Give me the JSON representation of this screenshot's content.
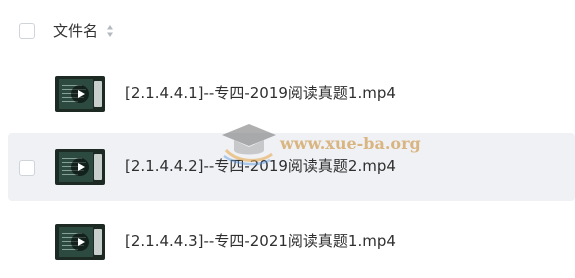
{
  "header": {
    "column_label": "文件名"
  },
  "files": [
    {
      "name": "[2.1.4.4.1]--专四-2019阅读真题1.mp4",
      "type": "video"
    },
    {
      "name": "[2.1.4.4.2]--专四-2019阅读真题2.mp4",
      "type": "video"
    },
    {
      "name": "[2.1.4.4.3]--专四-2021阅读真题1.mp4",
      "type": "video"
    }
  ],
  "watermark": {
    "text": "www.xue-ba.org"
  },
  "colors": {
    "hover_row": "#eff1f5",
    "checkbox_border": "#cfd3da",
    "text": "#2f2f2f",
    "watermark": "#d2a05a"
  },
  "icons": {
    "sort": "sort-icon",
    "file_thumb": "video-thumbnail-icon",
    "watermark_logo": "graduation-cap-icon"
  }
}
